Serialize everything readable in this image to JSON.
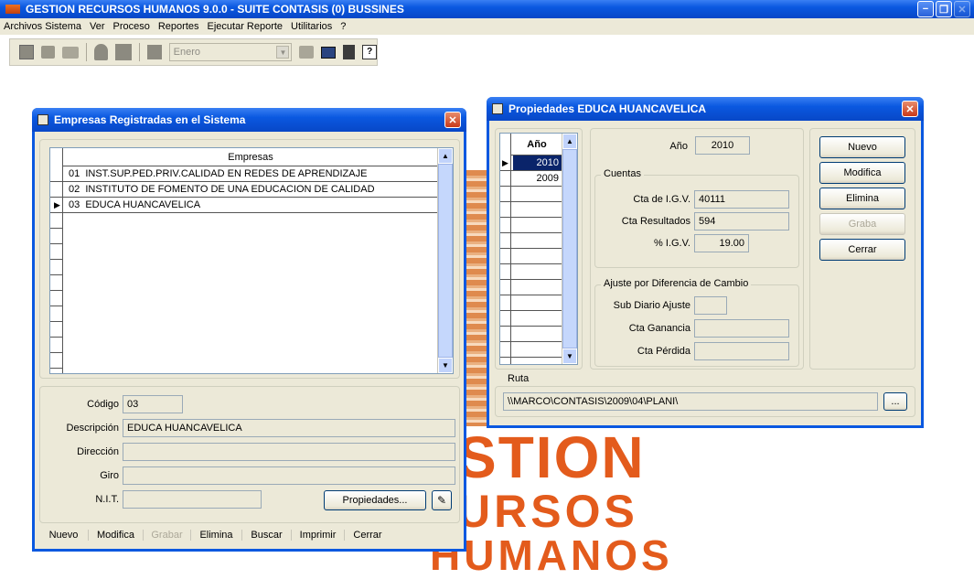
{
  "app": {
    "title": "GESTION RECURSOS HUMANOS 9.0.0 - SUITE CONTASIS (0) BUSSINES",
    "menu": [
      "Archivos Sistema",
      "Ver",
      "Proceso",
      "Reportes",
      "Ejecutar Reporte",
      "Utilitarios",
      "?"
    ],
    "toolbar": {
      "month_value": "Enero"
    },
    "background_logo": [
      "STION",
      "URSOS",
      "HUMANOS"
    ]
  },
  "empresas": {
    "title": "Empresas Registradas en el Sistema",
    "column_header": "Empresas",
    "rows": [
      {
        "text": "01  INST.SUP.PED.PRIV.CALIDAD EN REDES DE APRENDIZAJE",
        "selected": false
      },
      {
        "text": "02  INSTITUTO DE FOMENTO DE UNA EDUCACION DE CALIDAD",
        "selected": false
      },
      {
        "text": "03  EDUCA HUANCAVELICA",
        "selected": true
      }
    ],
    "form": {
      "codigo_label": "Código",
      "codigo_value": "03",
      "descripcion_label": "Descripción",
      "descripcion_value": "EDUCA HUANCAVELICA",
      "direccion_label": "Dirección",
      "direccion_value": "",
      "giro_label": "Giro",
      "giro_value": "",
      "nit_label": "N.I.T.",
      "nit_value": "",
      "propiedades_button": "Propiedades..."
    },
    "buttons": {
      "nuevo": "Nuevo",
      "modifica": "Modifica",
      "grabar": "Grabar",
      "elimina": "Elimina",
      "buscar": "Buscar",
      "imprimir": "Imprimir",
      "cerrar": "Cerrar"
    }
  },
  "propiedades": {
    "title": "Propiedades EDUCA HUANCAVELICA",
    "year_column": "Año",
    "years": [
      "2010",
      "2009"
    ],
    "anio_label": "Año",
    "anio_value": "2010",
    "cuentas_title": "Cuentas",
    "igv_label": "Cta de I.G.V.",
    "igv_value": "40111",
    "resultados_label": "Cta Resultados",
    "resultados_value": "594",
    "pct_igv_label": "% I.G.V.",
    "pct_igv_value": "19.00",
    "ajuste_title": "Ajuste por Diferencia de Cambio",
    "subdiario_label": "Sub Diario Ajuste",
    "subdiario_value": "",
    "ganancia_label": "Cta Ganancia",
    "ganancia_value": "",
    "perdida_label": "Cta Pérdida",
    "perdida_value": "",
    "ruta_label": "Ruta",
    "ruta_value": "\\\\MARCO\\CONTASIS\\2009\\04\\PLANI\\",
    "browse_button": "...",
    "buttons": {
      "nuevo": "Nuevo",
      "modifica": "Modifica",
      "elimina": "Elimina",
      "graba": "Graba",
      "cerrar": "Cerrar"
    }
  }
}
